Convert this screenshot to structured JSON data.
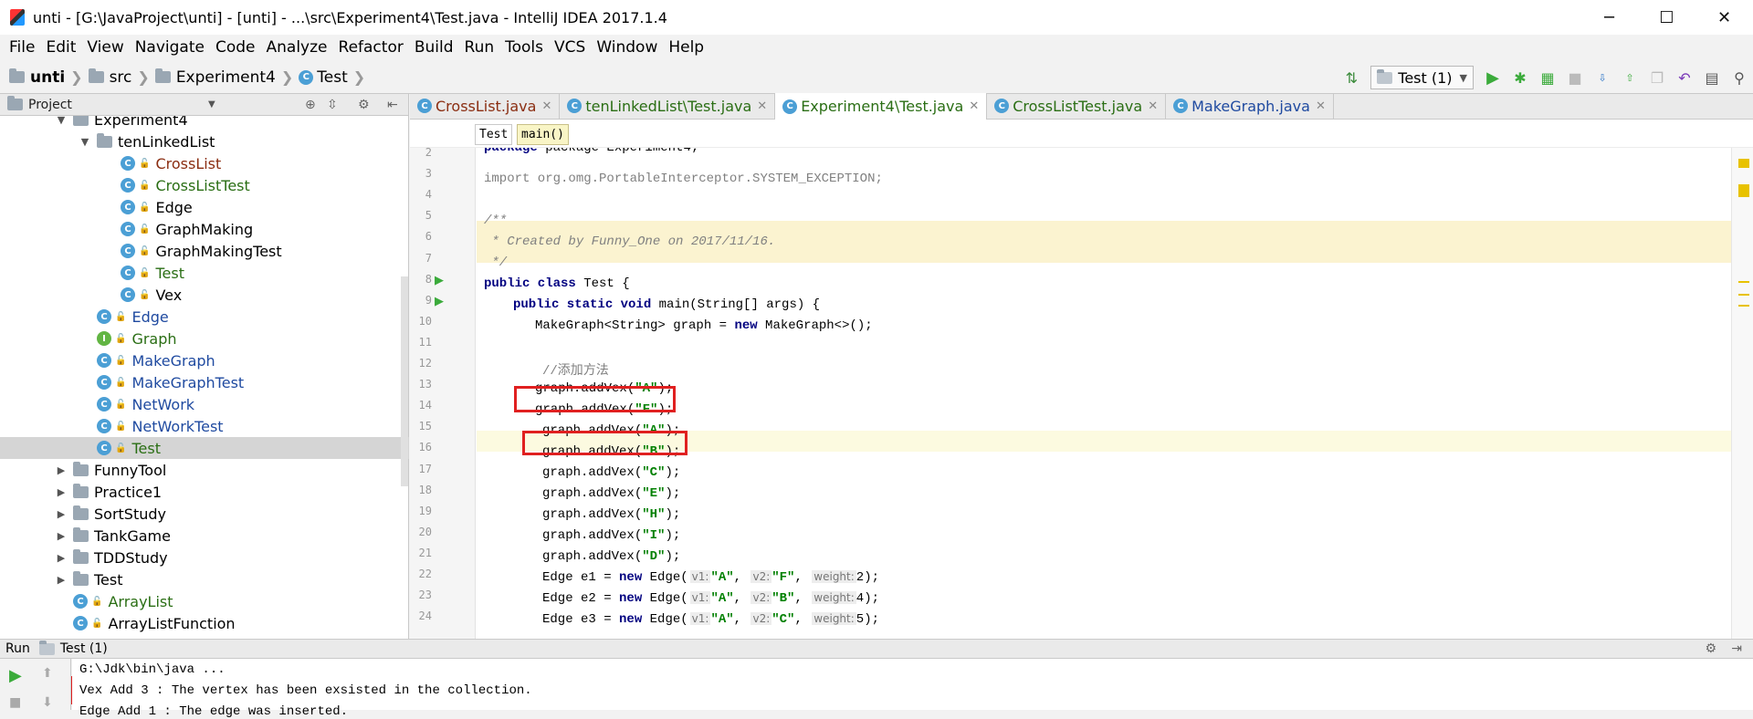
{
  "window": {
    "title": "unti - [G:\\JavaProject\\unti] - [unti] - ...\\src\\Experiment4\\Test.java - IntelliJ IDEA 2017.1.4",
    "controls": {
      "minimize": "─",
      "maximize": "☐",
      "close": "✕"
    }
  },
  "menu": [
    "File",
    "Edit",
    "View",
    "Navigate",
    "Code",
    "Analyze",
    "Refactor",
    "Build",
    "Run",
    "Tools",
    "VCS",
    "Window",
    "Help"
  ],
  "breadcrumb": {
    "project": "unti",
    "src": "src",
    "package": "Experiment4",
    "file": "Test"
  },
  "toolbar": {
    "run_config": "Test (1)"
  },
  "project_panel": {
    "title": "Project",
    "tree": [
      {
        "label": "Experiment4",
        "kind": "folder",
        "indent": 0,
        "open": true
      },
      {
        "label": "tenLinkedList",
        "kind": "folder",
        "indent": 1,
        "open": true
      },
      {
        "label": "CrossList",
        "kind": "class",
        "indent": 2,
        "color": "#8b2e12"
      },
      {
        "label": "CrossListTest",
        "kind": "class",
        "indent": 2,
        "color": "#2a6e14"
      },
      {
        "label": "Edge",
        "kind": "class",
        "indent": 2,
        "color": "#000000"
      },
      {
        "label": "GraphMaking",
        "kind": "class",
        "indent": 2,
        "color": "#000000"
      },
      {
        "label": "GraphMakingTest",
        "kind": "class",
        "indent": 2,
        "color": "#000000"
      },
      {
        "label": "Test",
        "kind": "class",
        "indent": 2,
        "color": "#2a6e14"
      },
      {
        "label": "Vex",
        "kind": "class",
        "indent": 2,
        "color": "#000000"
      },
      {
        "label": "Edge",
        "kind": "class",
        "indent": 1,
        "color": "#1f4aa0"
      },
      {
        "label": "Graph",
        "kind": "interface",
        "indent": 1,
        "color": "#2a6e14"
      },
      {
        "label": "MakeGraph",
        "kind": "class",
        "indent": 1,
        "color": "#1f4aa0"
      },
      {
        "label": "MakeGraphTest",
        "kind": "class",
        "indent": 1,
        "color": "#1f4aa0"
      },
      {
        "label": "NetWork",
        "kind": "class",
        "indent": 1,
        "color": "#1f4aa0"
      },
      {
        "label": "NetWorkTest",
        "kind": "class",
        "indent": 1,
        "color": "#1f4aa0"
      },
      {
        "label": "Test",
        "kind": "class",
        "indent": 1,
        "color": "#2a6e14",
        "selected": true
      },
      {
        "label": "FunnyTool",
        "kind": "folder",
        "indent": 0,
        "open": false
      },
      {
        "label": "Practice1",
        "kind": "folder",
        "indent": 0,
        "open": false
      },
      {
        "label": "SortStudy",
        "kind": "folder",
        "indent": 0,
        "open": false
      },
      {
        "label": "TankGame",
        "kind": "folder",
        "indent": 0,
        "open": false
      },
      {
        "label": "TDDStudy",
        "kind": "folder",
        "indent": 0,
        "open": false
      },
      {
        "label": "Test",
        "kind": "folder",
        "indent": 0,
        "open": false
      },
      {
        "label": "ArrayList",
        "kind": "class",
        "indent": 0,
        "color": "#2a6e14"
      },
      {
        "label": "ArrayListFunction",
        "kind": "class",
        "indent": 0,
        "color": "#000000"
      }
    ]
  },
  "tabs": [
    {
      "label": "CrossList.java",
      "color": "#8b2e12",
      "active": false
    },
    {
      "label": "tenLinkedList\\Test.java",
      "color": "#2a6e14",
      "active": false
    },
    {
      "label": "Experiment4\\Test.java",
      "color": "#2a6e14",
      "active": true
    },
    {
      "label": "CrossListTest.java",
      "color": "#2a6e14",
      "active": false
    },
    {
      "label": "MakeGraph.java",
      "color": "#1f4aa0",
      "active": false
    }
  ],
  "editor_crumbs": [
    "Test",
    "main()"
  ],
  "code": {
    "line_numbers": [
      "2",
      "3",
      "4",
      "5",
      "6",
      "7",
      "8",
      "9",
      "10",
      "11",
      "12",
      "13",
      "14",
      "15",
      "16",
      "17",
      "18",
      "19",
      "20",
      "21",
      "22",
      "23",
      "24"
    ],
    "pkg": "package Experiment4;",
    "import": "import org.omg.PortableInterceptor.SYSTEM_EXCEPTION;",
    "c1": "/**",
    "c2": " * Created by Funny_One on 2017/11/16.",
    "c3": " */",
    "class_kw": "public class",
    "class_rest": " Test {",
    "main_kw": "public static void",
    "main_rest": " main(String[] args) {",
    "mg_pre": "MakeGraph<String> graph = ",
    "new_kw": "new",
    "mg_post": " MakeGraph<>();",
    "zh_comment": "//添加方法",
    "addvex_prefix": "graph.addVex(",
    "addvex_suffix": ");",
    "vex_args": [
      "\"A\"",
      "\"F\"",
      "\"A\"",
      "\"B\"",
      "\"C\"",
      "\"E\"",
      "\"H\"",
      "\"I\"",
      "\"D\""
    ],
    "edges": [
      {
        "name": "Edge e1 = ",
        "v1": "\"A\"",
        "v2": "\"F\"",
        "w": "2"
      },
      {
        "name": "Edge e2 = ",
        "v1": "\"A\"",
        "v2": "\"B\"",
        "w": "4"
      },
      {
        "name": "Edge e3 = ",
        "v1": "\"A\"",
        "v2": "\"C\"",
        "w": "5"
      }
    ],
    "edge_ctor": " Edge(",
    "hint_v1": "v1:",
    "hint_v2": "v2:",
    "hint_w": "weight:",
    "comma": ", ",
    "close_paren": ");"
  },
  "run_panel": {
    "label": "Run",
    "tab": "Test (1)",
    "console": [
      "G:\\Jdk\\bin\\java ...",
      "Vex Add 3 : The vertex has been exsisted in the collection.",
      "Edge Add 1 : The edge was inserted."
    ]
  }
}
